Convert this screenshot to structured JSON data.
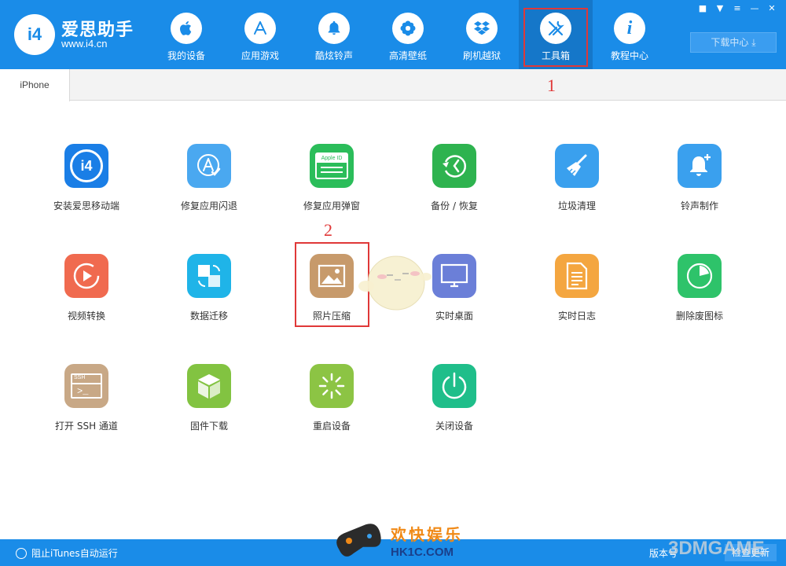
{
  "app": {
    "name": "爱思助手",
    "url": "www.i4.cn",
    "logo_text": "i4"
  },
  "nav": [
    {
      "label": "我的设备",
      "icon": "apple-icon"
    },
    {
      "label": "应用游戏",
      "icon": "app-store-icon"
    },
    {
      "label": "酷炫铃声",
      "icon": "bell-icon"
    },
    {
      "label": "高清壁纸",
      "icon": "flower-icon"
    },
    {
      "label": "刷机越狱",
      "icon": "dropbox-icon"
    },
    {
      "label": "工具箱",
      "icon": "tools-icon",
      "active": true
    },
    {
      "label": "教程中心",
      "icon": "info-icon"
    }
  ],
  "download_center": "下载中心",
  "device_tab": "iPhone",
  "annotations": {
    "one": "1",
    "two": "2"
  },
  "tools": [
    {
      "label": "安装爱思移动端",
      "icon": "i4-app-icon",
      "color": "#1a7ee6"
    },
    {
      "label": "修复应用闪退",
      "icon": "app-repair-icon",
      "color": "#4aa8f0"
    },
    {
      "label": "修复应用弹窗",
      "icon": "apple-id-icon",
      "color": "#2bbd5a",
      "badge": "Apple ID"
    },
    {
      "label": "备份 / 恢复",
      "icon": "backup-restore-icon",
      "color": "#2eb34f"
    },
    {
      "label": "垃圾清理",
      "icon": "broom-icon",
      "color": "#3aa0ee"
    },
    {
      "label": "铃声制作",
      "icon": "bell-plus-icon",
      "color": "#3aa0ee"
    },
    {
      "label": "视频转换",
      "icon": "video-icon",
      "color": "#f06a4f"
    },
    {
      "label": "数据迁移",
      "icon": "data-migrate-icon",
      "color": "#1fb4e8"
    },
    {
      "label": "照片压缩",
      "icon": "photo-icon",
      "color": "#c79a6b"
    },
    {
      "label": "实时桌面",
      "icon": "monitor-icon",
      "color": "#6b7fd8"
    },
    {
      "label": "实时日志",
      "icon": "document-icon",
      "color": "#f4a640"
    },
    {
      "label": "删除废图标",
      "icon": "pie-icon",
      "color": "#2ec36a"
    },
    {
      "label": "打开 SSH 通道",
      "icon": "terminal-icon",
      "color": "#c8a886",
      "badge": "SSH"
    },
    {
      "label": "固件下载",
      "icon": "cube-icon",
      "color": "#82c341"
    },
    {
      "label": "重启设备",
      "icon": "loading-icon",
      "color": "#8cc444"
    },
    {
      "label": "关闭设备",
      "icon": "power-icon",
      "color": "#1fbe8a"
    }
  ],
  "bottom": {
    "itunes_block": "阻止iTunes自动运行",
    "version_label": "版本号",
    "check_update": "检查更新"
  },
  "watermark": {
    "line1": "欢快娱乐",
    "line2": "HK1C.COM",
    "line3": "3DMGAME"
  }
}
